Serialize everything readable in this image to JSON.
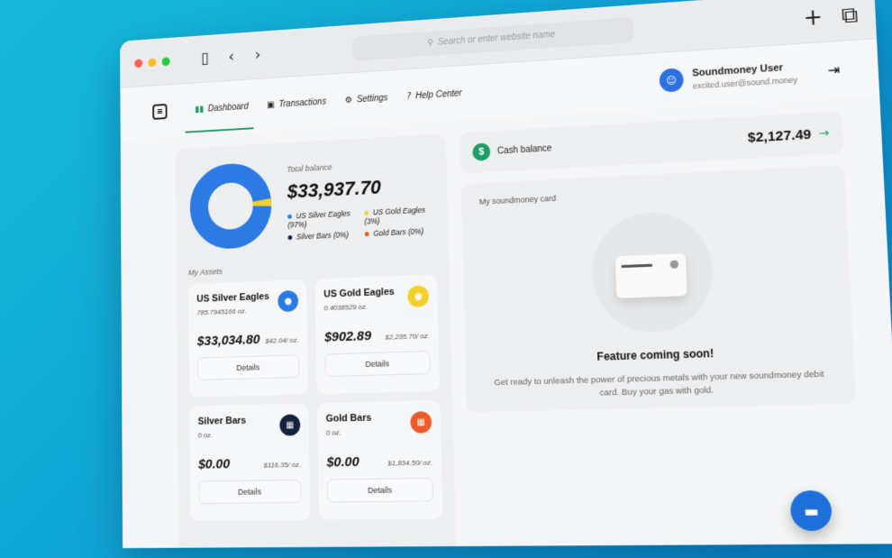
{
  "browser": {
    "address_placeholder": "Search or enter website name",
    "traffic_colors": [
      "#ff5f57",
      "#febc2e",
      "#28c840"
    ]
  },
  "nav": {
    "items": [
      {
        "label": "Dashboard",
        "icon": "dashboard-icon",
        "active": true
      },
      {
        "label": "Transactions",
        "icon": "transactions-icon",
        "active": false
      },
      {
        "label": "Settings",
        "icon": "gear-icon",
        "active": false
      },
      {
        "label": "Help Center",
        "icon": "help-icon",
        "active": false
      }
    ],
    "accent": "#1f9d62"
  },
  "user": {
    "name": "Soundmoney User",
    "email": "excited.user@sound.money"
  },
  "balance": {
    "label": "Total balance",
    "value": "$33,937.70",
    "legend": [
      {
        "label": "US Silver Eagles (97%)",
        "color": "#2c7be5"
      },
      {
        "label": "US Gold Eagles (3%)",
        "color": "#f3d02a"
      },
      {
        "label": "Silver Bars (0%)",
        "color": "#14213d"
      },
      {
        "label": "Gold Bars (0%)",
        "color": "#ee5a2a"
      }
    ],
    "donut_shares": [
      97,
      3,
      0,
      0
    ]
  },
  "assets": {
    "label": "My Assets",
    "items": [
      {
        "name": "US Silver Eagles",
        "oz": "785.7945166 oz.",
        "value": "$33,034.80",
        "price": "$42.04/ oz.",
        "details": "Details",
        "icon_color": "#2c7be5"
      },
      {
        "name": "US Gold Eagles",
        "oz": "0.4038529 oz.",
        "value": "$902.89",
        "price": "$2,235.70/ oz.",
        "details": "Details",
        "icon_color": "#f3d02a"
      },
      {
        "name": "Silver Bars",
        "oz": "0 oz.",
        "value": "$0.00",
        "price": "$116.35/ oz.",
        "details": "Details",
        "icon_color": "#14213d"
      },
      {
        "name": "Gold Bars",
        "oz": "0 oz.",
        "value": "$0.00",
        "price": "$1,834.50/ oz.",
        "details": "Details",
        "icon_color": "#ee5a2a"
      }
    ]
  },
  "cash": {
    "label": "Cash balance",
    "value": "$2,127.49"
  },
  "card": {
    "label": "My soundmoney card",
    "title": "Feature coming soon!",
    "description": "Get ready to unleash the power of precious metals with your new soundmoney debit card. Buy your gas with gold."
  }
}
